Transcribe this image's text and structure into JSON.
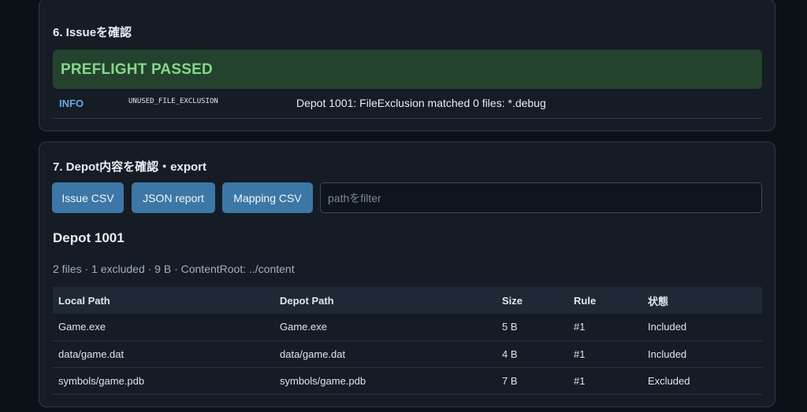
{
  "section6": {
    "title": "6. Issueを確認",
    "banner": "PREFLIGHT PASSED",
    "issues": [
      {
        "level": "INFO",
        "code": "UNUSED_FILE_EXCLUSION",
        "message": "Depot 1001: FileExclusion matched 0 files: *.debug"
      }
    ]
  },
  "section7": {
    "title": "7. Depot内容を確認・export",
    "buttons": {
      "issue_csv": "Issue CSV",
      "json_report": "JSON report",
      "mapping_csv": "Mapping CSV"
    },
    "filter": {
      "placeholder": "pathをfilter",
      "value": ""
    },
    "depot": {
      "title": "Depot 1001",
      "summary": "2 files · 1 excluded · 9 B · ContentRoot: ../content",
      "columns": [
        "Local Path",
        "Depot Path",
        "Size",
        "Rule",
        "状態"
      ],
      "rows": [
        [
          "Game.exe",
          "Game.exe",
          "5 B",
          "#1",
          "Included"
        ],
        [
          "data/game.dat",
          "data/game.dat",
          "4 B",
          "#1",
          "Included"
        ],
        [
          "symbols/game.pdb",
          "symbols/game.pdb",
          "7 B",
          "#1",
          "Excluded"
        ]
      ]
    }
  }
}
